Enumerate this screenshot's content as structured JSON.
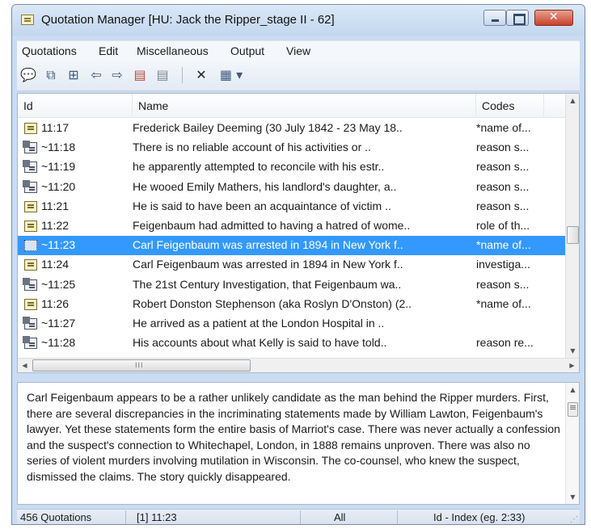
{
  "window": {
    "title": "Quotation Manager [HU: Jack the Ripper_stage II - 62]"
  },
  "menu": [
    "Quotations",
    "Edit",
    "Miscellaneous",
    "Output",
    "View"
  ],
  "toolbar": {
    "icons": [
      "speech-bubble-icon",
      "copy-windows-icon",
      "tree-icon",
      "arrow-left-icon",
      "arrow-right-icon",
      "grid-red-icon",
      "grid-gray-icon",
      "delete-x-icon",
      "view-dropdown-icon"
    ],
    "delete_glyph": "✕"
  },
  "list": {
    "columns": [
      "Id",
      "Name",
      "Codes"
    ],
    "rows": [
      {
        "icon": "quote",
        "id": "11:17",
        "name": "Frederick Bailey Deeming (30 July 1842 - 23 May 18..",
        "codes": "*name of..."
      },
      {
        "icon": "linked",
        "id": "~11:18",
        "name": "There is no reliable account of his activities or ..",
        "codes": "reason s..."
      },
      {
        "icon": "linked",
        "id": "~11:19",
        "name": "he apparently attempted to reconcile with his estr..",
        "codes": "reason s..."
      },
      {
        "icon": "linked",
        "id": "~11:20",
        "name": "He wooed Emily Mathers, his landlord's daughter, a..",
        "codes": "reason s..."
      },
      {
        "icon": "quote",
        "id": "11:21",
        "name": "He is said to have been an acquaintance of victim ..",
        "codes": "reason s..."
      },
      {
        "icon": "quote",
        "id": "11:22",
        "name": "Feigenbaum had admitted to having a hatred of wome..",
        "codes": "role of th..."
      },
      {
        "icon": "sel",
        "id": "~11:23",
        "name": "Carl Feigenbaum was arrested in 1894 in New York f..",
        "codes": "*name of...",
        "selected": true
      },
      {
        "icon": "quote",
        "id": "11:24",
        "name": "Carl Feigenbaum was arrested in 1894 in New York f..",
        "codes": "investiga..."
      },
      {
        "icon": "linked",
        "id": "~11:25",
        "name": "The 21st Century Investigation, that Feigenbaum wa..",
        "codes": "reason s..."
      },
      {
        "icon": "quote",
        "id": "11:26",
        "name": "Robert Donston Stephenson (aka Roslyn D'Onston) (2..",
        "codes": "*name of..."
      },
      {
        "icon": "linked",
        "id": "~11:27",
        "name": "He arrived as a patient at the London Hospital in ..",
        "codes": ""
      },
      {
        "icon": "linked",
        "id": "~11:28",
        "name": "His accounts about what Kelly is said to have told..",
        "codes": "reason re..."
      }
    ]
  },
  "scroll": {
    "up": "▲",
    "down": "▼",
    "left": "◀",
    "right": "▶",
    "grip": "III"
  },
  "preview": {
    "text": "Carl Feigenbaum appears to be a rather unlikely candidate as the man behind the Ripper murders. First, there are several discrepancies in the incriminating statements made by William Lawton, Feigenbaum's lawyer. Yet these statements form the entire basis of Marriot's case. There was never actually a confession and the suspect's connection to Whitechapel, London, in 1888 remains unproven. There was also no series of violent murders involving mutilation in Wisconsin. The co-counsel, who knew the suspect, dismissed the claims. The story quickly disappeared."
  },
  "status": {
    "count": "456 Quotations",
    "current": "[1] 11:23",
    "filter": "All",
    "sort": "Id - Index (eg. 2:33)"
  }
}
